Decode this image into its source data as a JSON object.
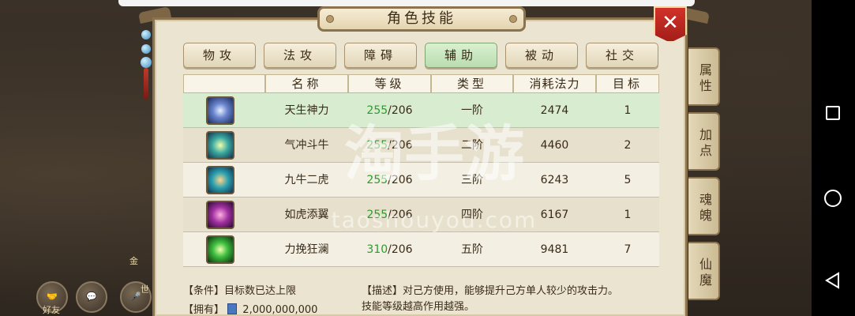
{
  "panel": {
    "title": "角色技能",
    "close_glyph": "✕"
  },
  "tabs": [
    {
      "label": "物攻",
      "active": false
    },
    {
      "label": "法攻",
      "active": false
    },
    {
      "label": "障碍",
      "active": false
    },
    {
      "label": "辅助",
      "active": true
    },
    {
      "label": "被动",
      "active": false
    },
    {
      "label": "社交",
      "active": false
    }
  ],
  "table": {
    "headers": [
      "",
      "名称",
      "等级",
      "类型",
      "消耗法力",
      "目标"
    ],
    "rows": [
      {
        "icon": "skill-crescent-icon",
        "name": "天生神力",
        "level_cur": "255",
        "level_max": "/206",
        "type": "一阶",
        "mana": "2474",
        "target": "1"
      },
      {
        "icon": "skill-sparkle-icon",
        "name": "气冲斗牛",
        "level_cur": "255",
        "level_max": "/206",
        "type": "二阶",
        "mana": "4460",
        "target": "2"
      },
      {
        "icon": "skill-flame-icon",
        "name": "九牛二虎",
        "level_cur": "255",
        "level_max": "/206",
        "type": "三阶",
        "mana": "6243",
        "target": "5"
      },
      {
        "icon": "skill-vortex-icon",
        "name": "如虎添翼",
        "level_cur": "255",
        "level_max": "/206",
        "type": "四阶",
        "mana": "6167",
        "target": "1"
      },
      {
        "icon": "skill-burst-icon",
        "name": "力挽狂澜",
        "level_cur": "310",
        "level_max": "/206",
        "type": "五阶",
        "mana": "9481",
        "target": "7"
      }
    ]
  },
  "info": {
    "condition": "【条件】目标数已达上限",
    "owned_label": "【拥有】",
    "owned_value": "2,000,000,000",
    "desc_line1": "【描述】对己方使用，能够提升己方单人较少的攻击力。",
    "desc_line2": "技能等级越高作用越强。"
  },
  "side_tabs": [
    "属性",
    "加点",
    "魂魄",
    "仙魔"
  ],
  "hud": {
    "friends_label": "好友",
    "gold_label": "金",
    "world_label": "世"
  },
  "watermark": {
    "main": "淘手游",
    "sub": "taoshouyou.com"
  },
  "colors": {
    "active_tab": "#b9ddb0",
    "level_green": "#2e9a2e",
    "close_red": "#c8281f"
  }
}
